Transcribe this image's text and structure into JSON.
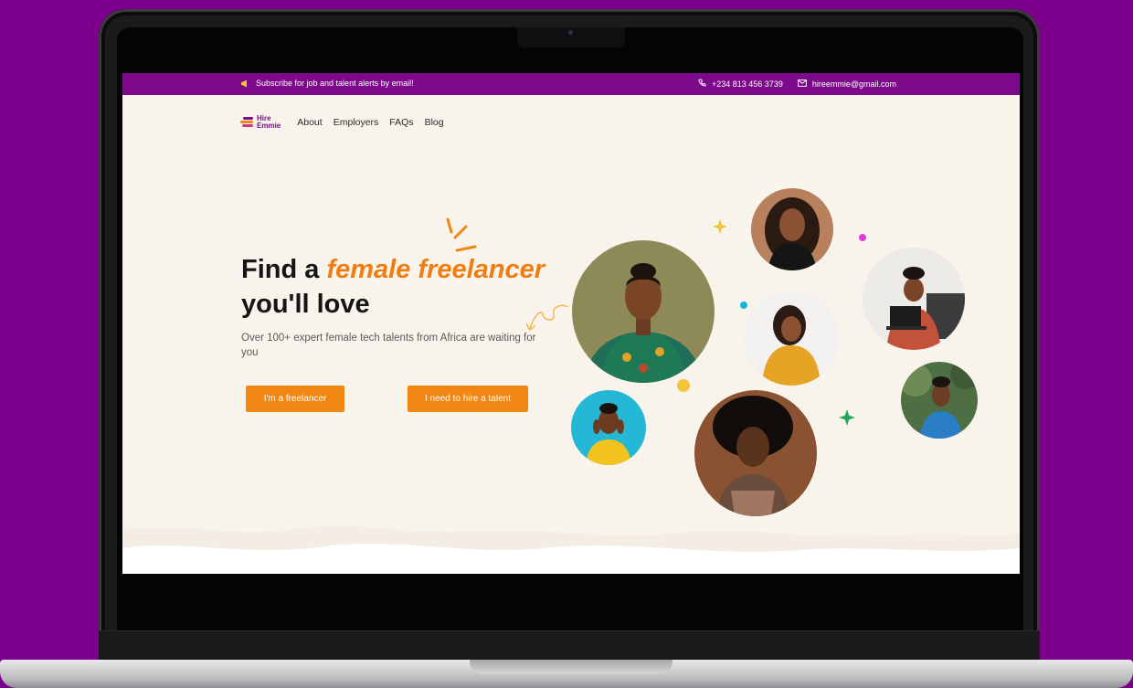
{
  "topbar": {
    "subscribe_text": "Subscribe for job and talent alerts by email!",
    "phone": "+234 813 456 3739",
    "email": "hireemmie@gmail.com"
  },
  "brand": {
    "line1": "Hire",
    "line2": "Emmie"
  },
  "nav": {
    "items": [
      "About",
      "Employers",
      "FAQs",
      "Blog"
    ]
  },
  "hero": {
    "title_part1": "Find a ",
    "title_accent": "female freelancer",
    "title_part2": "you'll love",
    "subtitle": "Over 100+ expert female tech talents from Africa are waiting for you",
    "primary_button": "I'm a freelancer",
    "secondary_button": "I need to hire a talent"
  },
  "colors": {
    "brand_purple": "#7d0a8a",
    "accent_orange": "#ef8712",
    "page_background": "#7b008c",
    "screen_background": "#f8f4ec"
  },
  "icons": [
    "megaphone-icon",
    "phone-icon",
    "mail-icon",
    "logo-icon"
  ]
}
